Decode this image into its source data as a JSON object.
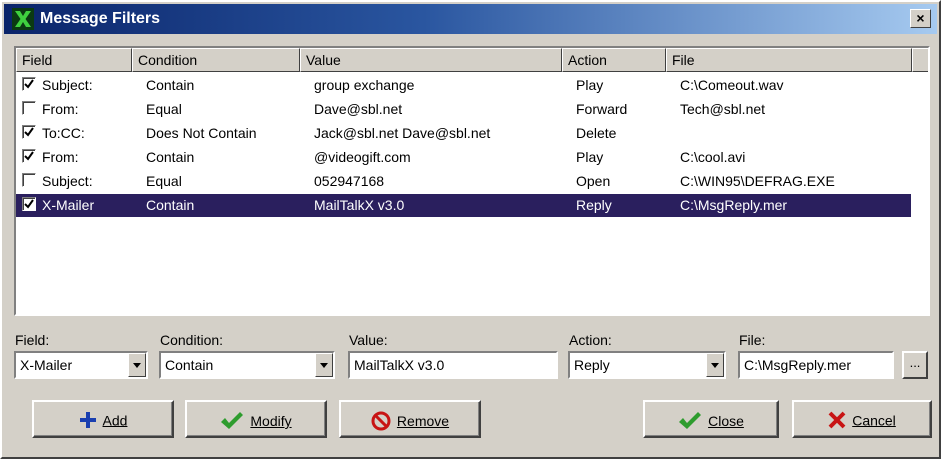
{
  "window": {
    "title": "Message Filters",
    "close_label": "×"
  },
  "list": {
    "columns": [
      "Field",
      "Condition",
      "Value",
      "Action",
      "File"
    ],
    "rows": [
      {
        "checked": true,
        "field": "Subject:",
        "condition": "Contain",
        "value": "group exchange",
        "action": "Play",
        "file": "C:\\Comeout.wav",
        "selected": false
      },
      {
        "checked": false,
        "field": "From:",
        "condition": "Equal",
        "value": "Dave@sbl.net",
        "action": "Forward",
        "file": "Tech@sbl.net",
        "selected": false
      },
      {
        "checked": true,
        "field": "To:CC:",
        "condition": "Does Not Contain",
        "value": "Jack@sbl.net Dave@sbl.net",
        "action": "Delete",
        "file": "",
        "selected": false
      },
      {
        "checked": true,
        "field": "From:",
        "condition": "Contain",
        "value": "@videogift.com",
        "action": "Play",
        "file": "C:\\cool.avi",
        "selected": false
      },
      {
        "checked": false,
        "field": "Subject:",
        "condition": "Equal",
        "value": "052947168",
        "action": "Open",
        "file": "C:\\WIN95\\DEFRAG.EXE",
        "selected": false
      },
      {
        "checked": true,
        "field": "X-Mailer",
        "condition": "Contain",
        "value": "MailTalkX v3.0",
        "action": "Reply",
        "file": "C:\\MsgReply.mer",
        "selected": true
      }
    ]
  },
  "editor": {
    "field_label": "Field:",
    "field_value": "X-Mailer",
    "condition_label": "Condition:",
    "condition_value": "Contain",
    "value_label": "Value:",
    "value_value": "MailTalkX v3.0",
    "action_label": "Action:",
    "action_value": "Reply",
    "file_label": "File:",
    "file_value": "C:\\MsgReply.mer",
    "browse_label": "..."
  },
  "buttons": {
    "add": "Add",
    "modify": "Modify",
    "remove": "Remove",
    "close": "Close",
    "cancel": "Cancel"
  },
  "colors": {
    "selection": "#2a1f5e",
    "check_green": "#2e9c2e",
    "add_blue": "#1a3fb0",
    "remove_red": "#c81414",
    "cancel_red": "#c81414"
  }
}
